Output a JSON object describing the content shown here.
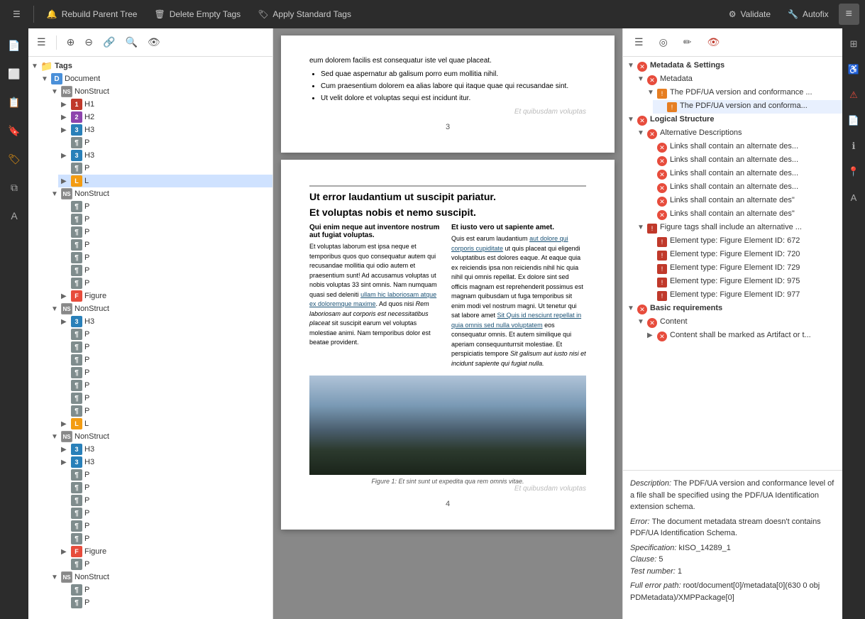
{
  "toolbar": {
    "rebuild_label": "Rebuild Parent Tree",
    "delete_label": "Delete Empty Tags",
    "apply_label": "Apply Standard Tags",
    "validate_label": "Validate",
    "autofix_label": "Autofix"
  },
  "tags_panel": {
    "header": "Tags",
    "root": "Document",
    "items": [
      {
        "level": 1,
        "type": "nonstruct",
        "label": "NonStruct",
        "expanded": true
      },
      {
        "level": 2,
        "type": "h1",
        "label": "H1"
      },
      {
        "level": 2,
        "type": "h2",
        "label": "H2"
      },
      {
        "level": 2,
        "type": "h3",
        "label": "H3"
      },
      {
        "level": 2,
        "type": "p",
        "label": "P"
      },
      {
        "level": 2,
        "type": "h3",
        "label": "H3"
      },
      {
        "level": 2,
        "type": "p",
        "label": "P"
      },
      {
        "level": 2,
        "type": "l",
        "label": "L",
        "selected": true
      },
      {
        "level": 1,
        "type": "nonstruct",
        "label": "NonStruct",
        "expanded": true
      },
      {
        "level": 2,
        "type": "p",
        "label": "P"
      },
      {
        "level": 2,
        "type": "p",
        "label": "P"
      },
      {
        "level": 2,
        "type": "p",
        "label": "P"
      },
      {
        "level": 2,
        "type": "p",
        "label": "P"
      },
      {
        "level": 2,
        "type": "p",
        "label": "P"
      },
      {
        "level": 2,
        "type": "p",
        "label": "P"
      },
      {
        "level": 2,
        "type": "p",
        "label": "P"
      },
      {
        "level": 2,
        "type": "figure",
        "label": "Figure"
      },
      {
        "level": 1,
        "type": "nonstruct",
        "label": "NonStruct",
        "expanded": true
      },
      {
        "level": 2,
        "type": "h3",
        "label": "H3"
      },
      {
        "level": 2,
        "type": "p",
        "label": "P"
      },
      {
        "level": 2,
        "type": "p",
        "label": "P"
      },
      {
        "level": 2,
        "type": "p",
        "label": "P"
      },
      {
        "level": 2,
        "type": "p",
        "label": "P"
      },
      {
        "level": 2,
        "type": "p",
        "label": "P"
      },
      {
        "level": 2,
        "type": "p",
        "label": "P"
      },
      {
        "level": 2,
        "type": "p",
        "label": "P"
      },
      {
        "level": 2,
        "type": "l",
        "label": "L"
      },
      {
        "level": 1,
        "type": "nonstruct",
        "label": "NonStruct",
        "expanded": true
      },
      {
        "level": 2,
        "type": "h3",
        "label": "H3"
      },
      {
        "level": 2,
        "type": "h3",
        "label": "H3"
      },
      {
        "level": 2,
        "type": "p",
        "label": "P"
      },
      {
        "level": 2,
        "type": "p",
        "label": "P"
      },
      {
        "level": 2,
        "type": "p",
        "label": "P"
      },
      {
        "level": 2,
        "type": "p",
        "label": "P"
      },
      {
        "level": 2,
        "type": "p",
        "label": "P"
      },
      {
        "level": 2,
        "type": "p",
        "label": "P"
      },
      {
        "level": 2,
        "type": "figure",
        "label": "Figure"
      },
      {
        "level": 2,
        "type": "p",
        "label": "P"
      },
      {
        "level": 1,
        "type": "nonstruct",
        "label": "NonStruct",
        "expanded": true
      },
      {
        "level": 2,
        "type": "p",
        "label": "P"
      },
      {
        "level": 2,
        "type": "p",
        "label": "P"
      }
    ]
  },
  "validation": {
    "sections": [
      {
        "label": "Metadata & Settings",
        "icon": "red",
        "expanded": true,
        "children": [
          {
            "label": "Metadata",
            "icon": "red",
            "expanded": true,
            "children": [
              {
                "label": "The PDF/UA version and conformance ...",
                "icon": "orange",
                "expanded": true,
                "children": [
                  {
                    "label": "The PDF/UA version and conforma...",
                    "icon": "orange"
                  }
                ]
              }
            ]
          }
        ]
      },
      {
        "label": "Logical Structure",
        "icon": "red",
        "expanded": true,
        "children": [
          {
            "label": "Alternative Descriptions",
            "icon": "red",
            "expanded": true,
            "children": [
              {
                "label": "Links shall contain an alternate des...",
                "icon": "red"
              },
              {
                "label": "Links shall contain an alternate des...",
                "icon": "red"
              },
              {
                "label": "Links shall contain an alternate des...",
                "icon": "red"
              },
              {
                "label": "Links shall contain an alternate des...",
                "icon": "red"
              },
              {
                "label": "Links shall contain an alternate des...",
                "icon": "red"
              },
              {
                "label": "Links shall contain an alternate des...",
                "icon": "red"
              }
            ]
          },
          {
            "label": "Figure tags shall include an alternative ...",
            "icon": "orange",
            "expanded": true,
            "children": [
              {
                "label": "Element type: Figure Element ID:  672",
                "icon": "orange"
              },
              {
                "label": "Element type: Figure Element ID:  720",
                "icon": "orange"
              },
              {
                "label": "Element type: Figure Element ID:  729",
                "icon": "orange"
              },
              {
                "label": "Element type: Figure Element ID:  975",
                "icon": "orange"
              },
              {
                "label": "Element type: Figure Element ID:  977",
                "icon": "orange"
              }
            ]
          }
        ]
      },
      {
        "label": "Basic requirements",
        "icon": "red",
        "expanded": true,
        "children": [
          {
            "label": "Content",
            "icon": "red",
            "expanded": true,
            "children": [
              {
                "label": "Content shall be marked as Artifact or t...",
                "icon": "red"
              }
            ]
          }
        ]
      }
    ],
    "description": {
      "desc_label": "Description:",
      "desc_text": " The PDF/UA version and conformance level of a file shall be specified using the PDF/UA Identification extension schema.",
      "error_label": "Error:",
      "error_text": " The document metadata stream doesn't contains PDF/UA Identification Schema.",
      "spec_label": "Specification:",
      "spec_text": " kISO_14289_1",
      "clause_label": "Clause:",
      "clause_text": " 5",
      "test_label": "Test number:",
      "test_text": " 1",
      "path_label": "Full error path:",
      "path_text": " root/document[0]/metadata[0](630 0 obj PDMetadata)/XMPPackage[0]"
    }
  },
  "pdf": {
    "page3_watermark": "Et quibusdam voluptas",
    "page3_intro": "eum dolorem facilis est consequatur iste vel quae placeat.",
    "page3_bullets": [
      "Sed quae aspernatur ab galisum porro eum mollitia nihil.",
      "Cum praesentium dolorem ea alias labore qui itaque quae qui recusandae sint.",
      "Ut velit dolore et voluptas sequi est incidunt itur."
    ],
    "page3_num": "3",
    "page4_watermark": "Et quibusdam voluptas",
    "page4_h2_1": "Ut error laudantium ut suscipit pariatur.",
    "page4_h2_2": "Et voluptas nobis et nemo suscipit.",
    "page4_col1_h": "Qui enim neque aut inventore nostrum aut fugiat voluptas.",
    "page4_col1_body": "Et voluptas laborum est ipsa neque et temporibus quos quo consequatur autem qui recusandae mollitia qui odio autem et praesentium sunt! Ad accusamus voluptas ut nobis voluptas 33 sint omnis. Nam numquam quasi sed deleniti ullam hic laboriosam atque ex doloremque maxime. Ad quos nisi Rem laboriosam aut corporis est necessitatibus placeat sit suscipit earum vel voluptas molestiae animi. Nam temporibus dolor est beatae provident.",
    "page4_col2_h": "Et iusto vero ut sapiente amet.",
    "page4_col2_body": "Quis est earum laudantium aut dolore qui corporis cupiditate ut quis placeat qui eligendi voluptatibus est dolores eaque. At eaque quia ex reiciendis ipsa non reiciendis nihil hic quia nihil qui omnis repellat. Ex dolore sint sed officis magnam est reprehenderit possimus est magnam quibusdam ut fuga temporibus sit enim modi vel nostrum magni. Ut tenetur qui sat labore amet Sit Quis id nesciunt repellat in quia omnis sed nulla voluptatem eos consequatur omnis. Et autem similique qui aperiam consequunturrsit molestiae. Et perspiciatis tempore Sit galisum aut iusto nisi et incidunt sapiente qui fugiat nulla.",
    "page4_figure_caption": "Figure 1: Et sint sunt ut expedita qua rem omnis vitae.",
    "page4_num": "4"
  }
}
